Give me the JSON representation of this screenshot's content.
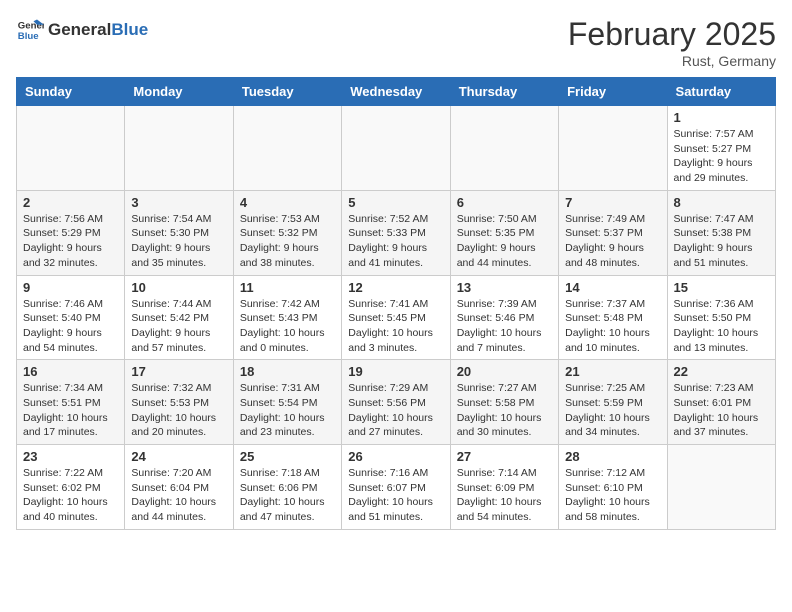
{
  "logo": {
    "text_general": "General",
    "text_blue": "Blue"
  },
  "title": {
    "month": "February 2025",
    "location": "Rust, Germany"
  },
  "headers": [
    "Sunday",
    "Monday",
    "Tuesday",
    "Wednesday",
    "Thursday",
    "Friday",
    "Saturday"
  ],
  "weeks": [
    [
      {
        "day": "",
        "info": ""
      },
      {
        "day": "",
        "info": ""
      },
      {
        "day": "",
        "info": ""
      },
      {
        "day": "",
        "info": ""
      },
      {
        "day": "",
        "info": ""
      },
      {
        "day": "",
        "info": ""
      },
      {
        "day": "1",
        "info": "Sunrise: 7:57 AM\nSunset: 5:27 PM\nDaylight: 9 hours and 29 minutes."
      }
    ],
    [
      {
        "day": "2",
        "info": "Sunrise: 7:56 AM\nSunset: 5:29 PM\nDaylight: 9 hours and 32 minutes."
      },
      {
        "day": "3",
        "info": "Sunrise: 7:54 AM\nSunset: 5:30 PM\nDaylight: 9 hours and 35 minutes."
      },
      {
        "day": "4",
        "info": "Sunrise: 7:53 AM\nSunset: 5:32 PM\nDaylight: 9 hours and 38 minutes."
      },
      {
        "day": "5",
        "info": "Sunrise: 7:52 AM\nSunset: 5:33 PM\nDaylight: 9 hours and 41 minutes."
      },
      {
        "day": "6",
        "info": "Sunrise: 7:50 AM\nSunset: 5:35 PM\nDaylight: 9 hours and 44 minutes."
      },
      {
        "day": "7",
        "info": "Sunrise: 7:49 AM\nSunset: 5:37 PM\nDaylight: 9 hours and 48 minutes."
      },
      {
        "day": "8",
        "info": "Sunrise: 7:47 AM\nSunset: 5:38 PM\nDaylight: 9 hours and 51 minutes."
      }
    ],
    [
      {
        "day": "9",
        "info": "Sunrise: 7:46 AM\nSunset: 5:40 PM\nDaylight: 9 hours and 54 minutes."
      },
      {
        "day": "10",
        "info": "Sunrise: 7:44 AM\nSunset: 5:42 PM\nDaylight: 9 hours and 57 minutes."
      },
      {
        "day": "11",
        "info": "Sunrise: 7:42 AM\nSunset: 5:43 PM\nDaylight: 10 hours and 0 minutes."
      },
      {
        "day": "12",
        "info": "Sunrise: 7:41 AM\nSunset: 5:45 PM\nDaylight: 10 hours and 3 minutes."
      },
      {
        "day": "13",
        "info": "Sunrise: 7:39 AM\nSunset: 5:46 PM\nDaylight: 10 hours and 7 minutes."
      },
      {
        "day": "14",
        "info": "Sunrise: 7:37 AM\nSunset: 5:48 PM\nDaylight: 10 hours and 10 minutes."
      },
      {
        "day": "15",
        "info": "Sunrise: 7:36 AM\nSunset: 5:50 PM\nDaylight: 10 hours and 13 minutes."
      }
    ],
    [
      {
        "day": "16",
        "info": "Sunrise: 7:34 AM\nSunset: 5:51 PM\nDaylight: 10 hours and 17 minutes."
      },
      {
        "day": "17",
        "info": "Sunrise: 7:32 AM\nSunset: 5:53 PM\nDaylight: 10 hours and 20 minutes."
      },
      {
        "day": "18",
        "info": "Sunrise: 7:31 AM\nSunset: 5:54 PM\nDaylight: 10 hours and 23 minutes."
      },
      {
        "day": "19",
        "info": "Sunrise: 7:29 AM\nSunset: 5:56 PM\nDaylight: 10 hours and 27 minutes."
      },
      {
        "day": "20",
        "info": "Sunrise: 7:27 AM\nSunset: 5:58 PM\nDaylight: 10 hours and 30 minutes."
      },
      {
        "day": "21",
        "info": "Sunrise: 7:25 AM\nSunset: 5:59 PM\nDaylight: 10 hours and 34 minutes."
      },
      {
        "day": "22",
        "info": "Sunrise: 7:23 AM\nSunset: 6:01 PM\nDaylight: 10 hours and 37 minutes."
      }
    ],
    [
      {
        "day": "23",
        "info": "Sunrise: 7:22 AM\nSunset: 6:02 PM\nDaylight: 10 hours and 40 minutes."
      },
      {
        "day": "24",
        "info": "Sunrise: 7:20 AM\nSunset: 6:04 PM\nDaylight: 10 hours and 44 minutes."
      },
      {
        "day": "25",
        "info": "Sunrise: 7:18 AM\nSunset: 6:06 PM\nDaylight: 10 hours and 47 minutes."
      },
      {
        "day": "26",
        "info": "Sunrise: 7:16 AM\nSunset: 6:07 PM\nDaylight: 10 hours and 51 minutes."
      },
      {
        "day": "27",
        "info": "Sunrise: 7:14 AM\nSunset: 6:09 PM\nDaylight: 10 hours and 54 minutes."
      },
      {
        "day": "28",
        "info": "Sunrise: 7:12 AM\nSunset: 6:10 PM\nDaylight: 10 hours and 58 minutes."
      },
      {
        "day": "",
        "info": ""
      }
    ]
  ]
}
